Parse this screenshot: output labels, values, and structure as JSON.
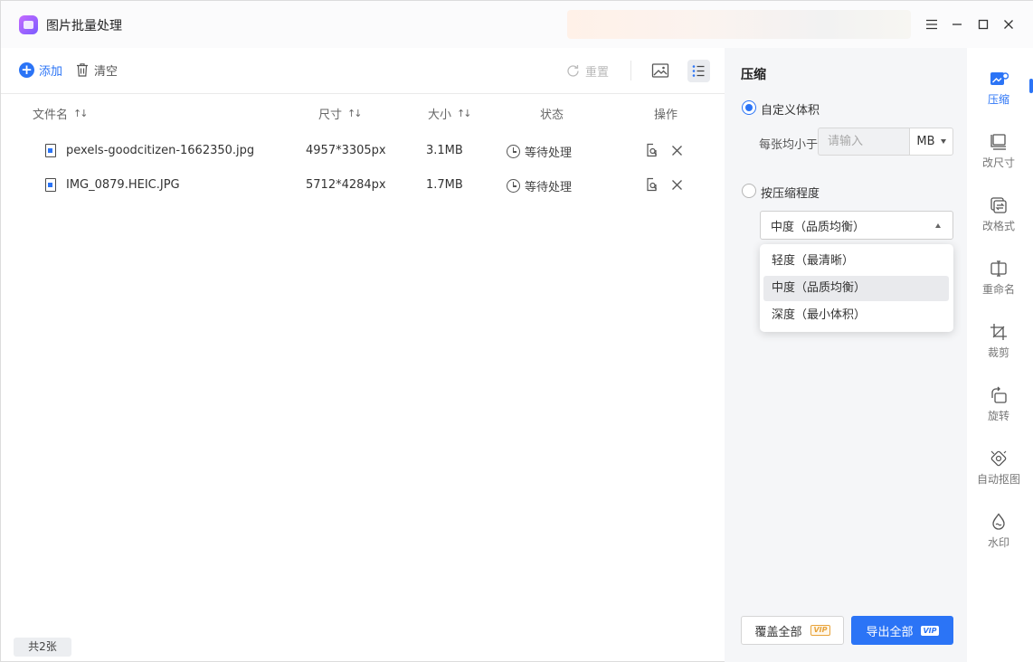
{
  "app": {
    "title": "图片批量处理"
  },
  "toolbar": {
    "add_label": "添加",
    "clear_label": "清空",
    "reset_label": "重置"
  },
  "table": {
    "headers": {
      "filename": "文件名",
      "dimensions": "尺寸",
      "size": "大小",
      "status": "状态",
      "actions": "操作"
    },
    "sort_glyph": "↑↓",
    "rows": [
      {
        "filename": "pexels-goodcitizen-1662350.jpg",
        "dimensions": "4957*3305px",
        "size": "3.1MB",
        "status": "等待处理"
      },
      {
        "filename": "IMG_0879.HEIC.JPG",
        "dimensions": "5712*4284px",
        "size": "1.7MB",
        "status": "等待处理"
      }
    ]
  },
  "footer": {
    "count_label": "共2张"
  },
  "panel": {
    "title": "压缩",
    "custom_volume": {
      "label": "自定义体积",
      "selected": true
    },
    "per_image_label": "每张均小于",
    "size_input": {
      "value": "",
      "placeholder": "请输入"
    },
    "unit": "MB",
    "by_level": {
      "label": "按压缩程度",
      "selected": false
    },
    "level_select": {
      "value": "中度（品质均衡）"
    },
    "level_options": [
      "轻度（最清晰）",
      "中度（品质均衡）",
      "深度（最小体积）"
    ],
    "selected_option_index": 1,
    "overwrite_label": "覆盖全部",
    "export_label": "导出全部",
    "vip_label": "VIP"
  },
  "sidebar": {
    "items": [
      {
        "label": "压缩",
        "icon": "compress-icon",
        "active": true
      },
      {
        "label": "改尺寸",
        "icon": "resize-icon",
        "active": false
      },
      {
        "label": "改格式",
        "icon": "format-icon",
        "active": false
      },
      {
        "label": "重命名",
        "icon": "rename-icon",
        "active": false
      },
      {
        "label": "裁剪",
        "icon": "crop-icon",
        "active": false
      },
      {
        "label": "旋转",
        "icon": "rotate-icon",
        "active": false
      },
      {
        "label": "自动抠图",
        "icon": "cutout-icon",
        "active": false
      },
      {
        "label": "水印",
        "icon": "watermark-icon",
        "active": false
      }
    ]
  },
  "colors": {
    "accent": "#2b74f6",
    "panel_bg": "#f5f6f8",
    "vip_gold": "#e8a33a"
  }
}
